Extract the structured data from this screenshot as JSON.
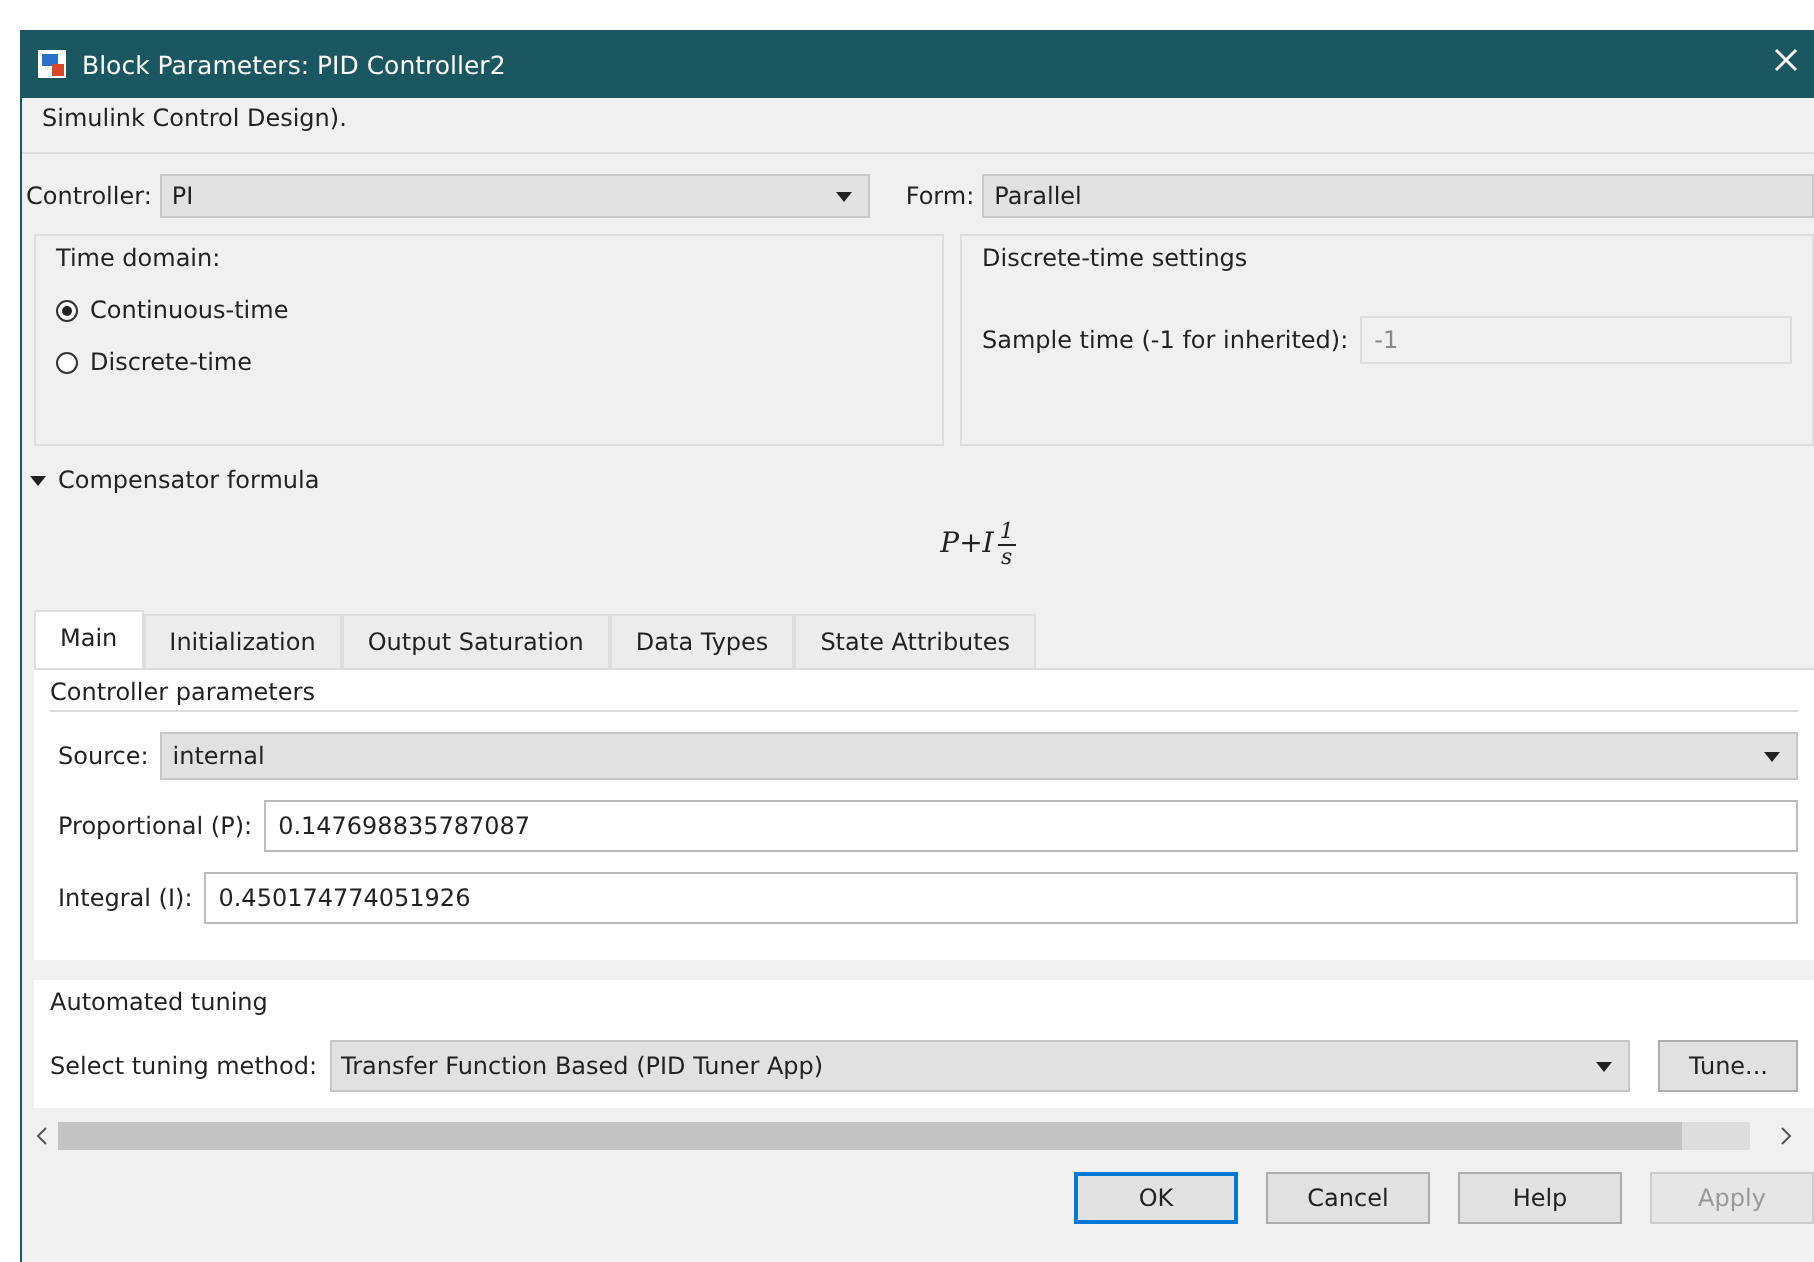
{
  "window": {
    "title": "Block Parameters: PID Controller2"
  },
  "description": "Simulink Control Design).",
  "controller": {
    "label": "Controller:",
    "value": "PI"
  },
  "form": {
    "label": "Form:",
    "value": "Parallel"
  },
  "time_domain": {
    "title": "Time domain:",
    "options": [
      {
        "label": "Continuous-time",
        "selected": true
      },
      {
        "label": "Discrete-time",
        "selected": false
      }
    ]
  },
  "discrete_settings": {
    "title": "Discrete-time settings",
    "label": "Sample time (-1 for inherited):",
    "value": "-1",
    "disabled": true
  },
  "compensator": {
    "label": "Compensator formula",
    "expanded": true,
    "formula": {
      "terms": "P+I",
      "numerator": "1",
      "denominator": "s"
    }
  },
  "tabs": [
    {
      "label": "Main",
      "selected": true
    },
    {
      "label": "Initialization",
      "selected": false
    },
    {
      "label": "Output Saturation",
      "selected": false
    },
    {
      "label": "Data Types",
      "selected": false
    },
    {
      "label": "State Attributes",
      "selected": false
    }
  ],
  "controller_parameters": {
    "title": "Controller parameters",
    "source": {
      "label": "Source:",
      "value": "internal"
    },
    "fields": [
      {
        "label": "Proportional (P):",
        "value": "0.147698835787087"
      },
      {
        "label": "Integral (I):",
        "value": "0.450174774051926"
      }
    ]
  },
  "automated_tuning": {
    "title": "Automated tuning",
    "label": "Select tuning method:",
    "value": "Transfer Function Based (PID Tuner App)",
    "button": "Tune..."
  },
  "buttons": [
    {
      "label": "OK",
      "disabled": false,
      "default": true
    },
    {
      "label": "Cancel",
      "disabled": false,
      "default": false
    },
    {
      "label": "Help",
      "disabled": false,
      "default": false
    },
    {
      "label": "Apply",
      "disabled": true,
      "default": false
    }
  ]
}
